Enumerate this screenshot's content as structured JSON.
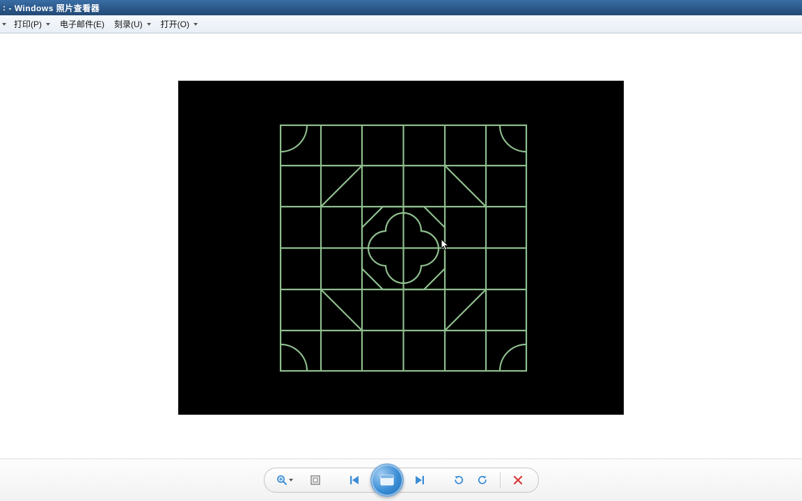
{
  "window": {
    "title_prefix": ":",
    "title_suffix": "- Windows 照片查看器"
  },
  "menu": {
    "print": "打印(P)",
    "email": "电子邮件(E)",
    "burn": "刻录(U)",
    "open": "打开(O)"
  },
  "toolbar": {
    "zoom_label": "Zoom",
    "fit_label": "Actual size",
    "prev_label": "Previous",
    "slideshow_label": "Play slideshow",
    "next_label": "Next",
    "rotate_ccw_label": "Rotate counterclockwise",
    "rotate_cw_label": "Rotate clockwise",
    "delete_label": "Delete"
  },
  "colors": {
    "titlebar": "#2c5a8c",
    "pattern_stroke": "#8fbf8f",
    "delete_red": "#d93636",
    "play_blue": "#3b8ed6"
  }
}
